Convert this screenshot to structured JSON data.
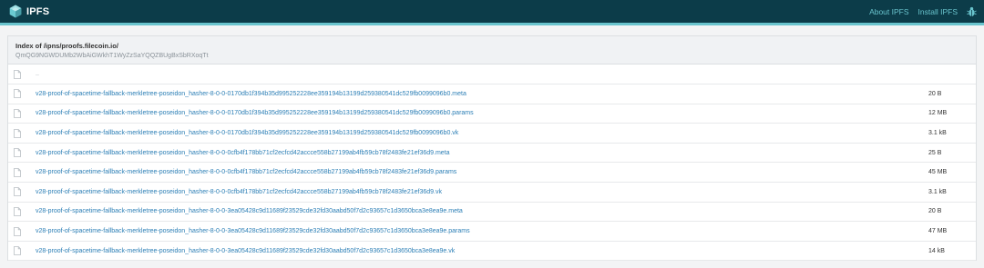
{
  "brand": {
    "label": "IPFS"
  },
  "nav": [
    {
      "label": "About IPFS"
    },
    {
      "label": "Install IPFS"
    }
  ],
  "index": {
    "title": "Index of /ipns/proofs.filecoin.io/",
    "hash": "QmQG9NGWDUMb2WbAiGWkhT1WyZzSaYQQZBUgBxSbRXoqTt"
  },
  "parent_link": "..",
  "files": [
    {
      "name": "v28-proof-of-spacetime-fallback-merkletree-poseidon_hasher-8-0-0-0170db1f394b35d995252228ee359194b13199d259380541dc529fb0099096b0.meta",
      "size": "20 B"
    },
    {
      "name": "v28-proof-of-spacetime-fallback-merkletree-poseidon_hasher-8-0-0-0170db1f394b35d995252228ee359194b13199d259380541dc529fb0099096b0.params",
      "size": "12 MB"
    },
    {
      "name": "v28-proof-of-spacetime-fallback-merkletree-poseidon_hasher-8-0-0-0170db1f394b35d995252228ee359194b13199d259380541dc529fb0099096b0.vk",
      "size": "3.1 kB"
    },
    {
      "name": "v28-proof-of-spacetime-fallback-merkletree-poseidon_hasher-8-0-0-0cfb4f178bb71cf2ecfcd42accce558b27199ab4fb59cb78f2483fe21ef36d9.meta",
      "size": "25 B"
    },
    {
      "name": "v28-proof-of-spacetime-fallback-merkletree-poseidon_hasher-8-0-0-0cfb4f178bb71cf2ecfcd42accce558b27199ab4fb59cb78f2483fe21ef36d9.params",
      "size": "45 MB"
    },
    {
      "name": "v28-proof-of-spacetime-fallback-merkletree-poseidon_hasher-8-0-0-0cfb4f178bb71cf2ecfcd42accce558b27199ab4fb59cb78f2483fe21ef36d9.vk",
      "size": "3.1 kB"
    },
    {
      "name": "v28-proof-of-spacetime-fallback-merkletree-poseidon_hasher-8-0-0-3ea05428c9d11689f23529cde32fd30aabd50f7d2c93657c1d3650bca3e8ea9e.meta",
      "size": "20 B"
    },
    {
      "name": "v28-proof-of-spacetime-fallback-merkletree-poseidon_hasher-8-0-0-3ea05428c9d11689f23529cde32fd30aabd50f7d2c93657c1d3650bca3e8ea9e.params",
      "size": "47 MB"
    },
    {
      "name": "v28-proof-of-spacetime-fallback-merkletree-poseidon_hasher-8-0-0-3ea05428c9d11689f23529cde32fd30aabd50f7d2c93657c1d3650bca3e8ea9e.vk",
      "size": "14 kB"
    }
  ],
  "colors": {
    "topbar": "#0c3c49",
    "accent": "#69c4cd",
    "link": "#2c7fb6"
  }
}
